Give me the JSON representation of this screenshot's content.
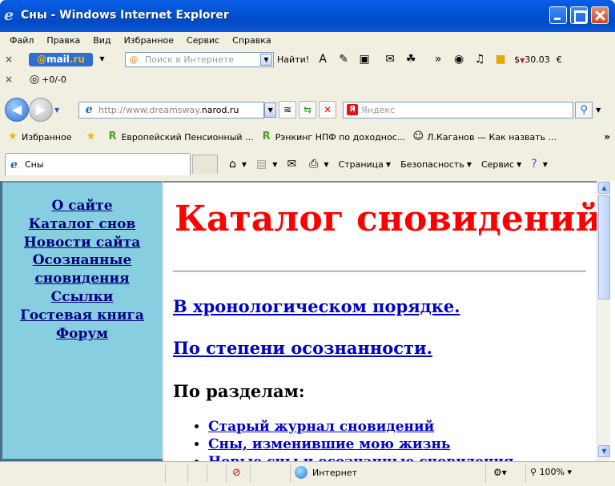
{
  "window": {
    "title": "Сны - Windows Internet Explorer"
  },
  "menu": [
    "Файл",
    "Правка",
    "Вид",
    "Избранное",
    "Сервис",
    "Справка"
  ],
  "mail_toolbar": {
    "logo_prefix": "@",
    "logo_main": "mail",
    "logo_tld": ".ru",
    "search_placeholder": "Поиск в Интернете",
    "search_button": "Найти!",
    "currency": "$",
    "rate": "30.03",
    "currency2": "€"
  },
  "extra_toolbar": {
    "counter": "+0/-0"
  },
  "address_bar": {
    "url_prefix": "http://www.dreamsway.",
    "url_domain": "narod.ru",
    "search_placeholder": "Яндекс"
  },
  "favorites_bar": {
    "label": "Избранное",
    "links": [
      "Европейский Пенсионный ...",
      "Рэнкинг НПФ по доходнос...",
      "Л.Каганов — Как назвать ..."
    ]
  },
  "tab_row": {
    "tab_title": "Сны",
    "commands": [
      "Страница",
      "Безопасность",
      "Сервис"
    ]
  },
  "sidebar": {
    "links": [
      "О сайте",
      "Каталог снов",
      "Новости сайта",
      "Осознанные",
      "сновидения",
      "Ссылки",
      "Гостевая книга",
      "Форум"
    ]
  },
  "page": {
    "heading": "Каталог сновидений",
    "link_chrono": "В хронологическом порядке.",
    "link_lucidity": "По степени осознанности.",
    "sections_label": "По разделам:",
    "section_links": [
      "Старый журнал сновидений",
      "Сны, изменившие мою жизнь",
      "Новые сны и осознанные сновидения"
    ]
  },
  "statusbar": {
    "zone": "Интернет",
    "zoom": "100%"
  },
  "colors": {
    "titlebar": "#0455d8",
    "sidebar_bg": "#87cee0",
    "heading": "#ff0000",
    "link": "#0000cc"
  }
}
